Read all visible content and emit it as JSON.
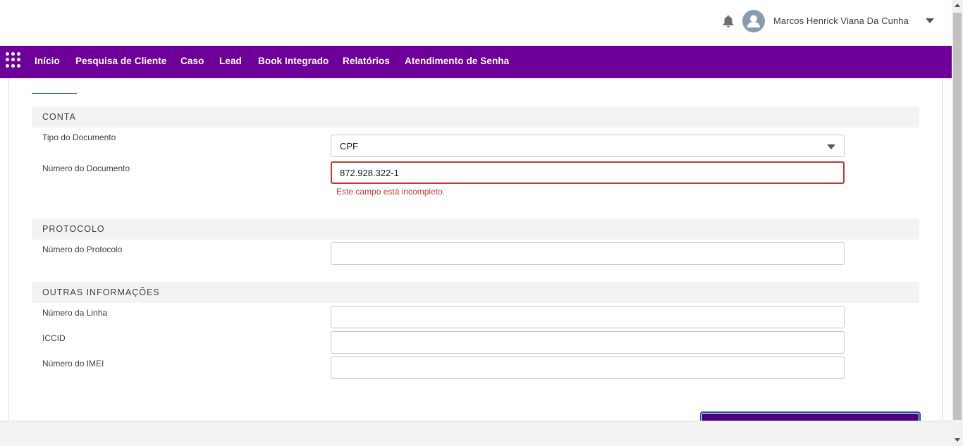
{
  "header": {
    "bell_icon": "bell-icon",
    "avatar_icon": "user-avatar-icon",
    "user_name": "Marcos Henrick Viana Da Cunha"
  },
  "nav": {
    "launcher_icon": "app-launcher-grid-icon",
    "items": [
      {
        "label": "Início"
      },
      {
        "label": "Pesquisa de Cliente"
      },
      {
        "label": "Caso"
      },
      {
        "label": "Lead"
      },
      {
        "label": "Book Integrado"
      },
      {
        "label": "Relatórios"
      },
      {
        "label": "Atendimento de Senha"
      }
    ]
  },
  "form": {
    "conta": {
      "title": "CONTA",
      "tipo_label": "Tipo do Documento",
      "tipo_value": "CPF",
      "numero_label": "Número do Documento",
      "numero_value": "872.928.322-1",
      "numero_error": "Este campo está incompleto."
    },
    "protocolo": {
      "title": "PROTOCOLO",
      "numero_label": "Número do Protocolo",
      "numero_value": ""
    },
    "outras": {
      "title": "OUTRAS INFORMAÇÕES",
      "linha_label": "Número da Linha",
      "linha_value": "",
      "iccid_label": "ICCID",
      "iccid_value": "",
      "imei_label": "Número do IMEI",
      "imei_value": ""
    }
  },
  "colors": {
    "nav_bg": "#6c0099",
    "error": "#c23934",
    "button_bg": "#4b007a"
  }
}
